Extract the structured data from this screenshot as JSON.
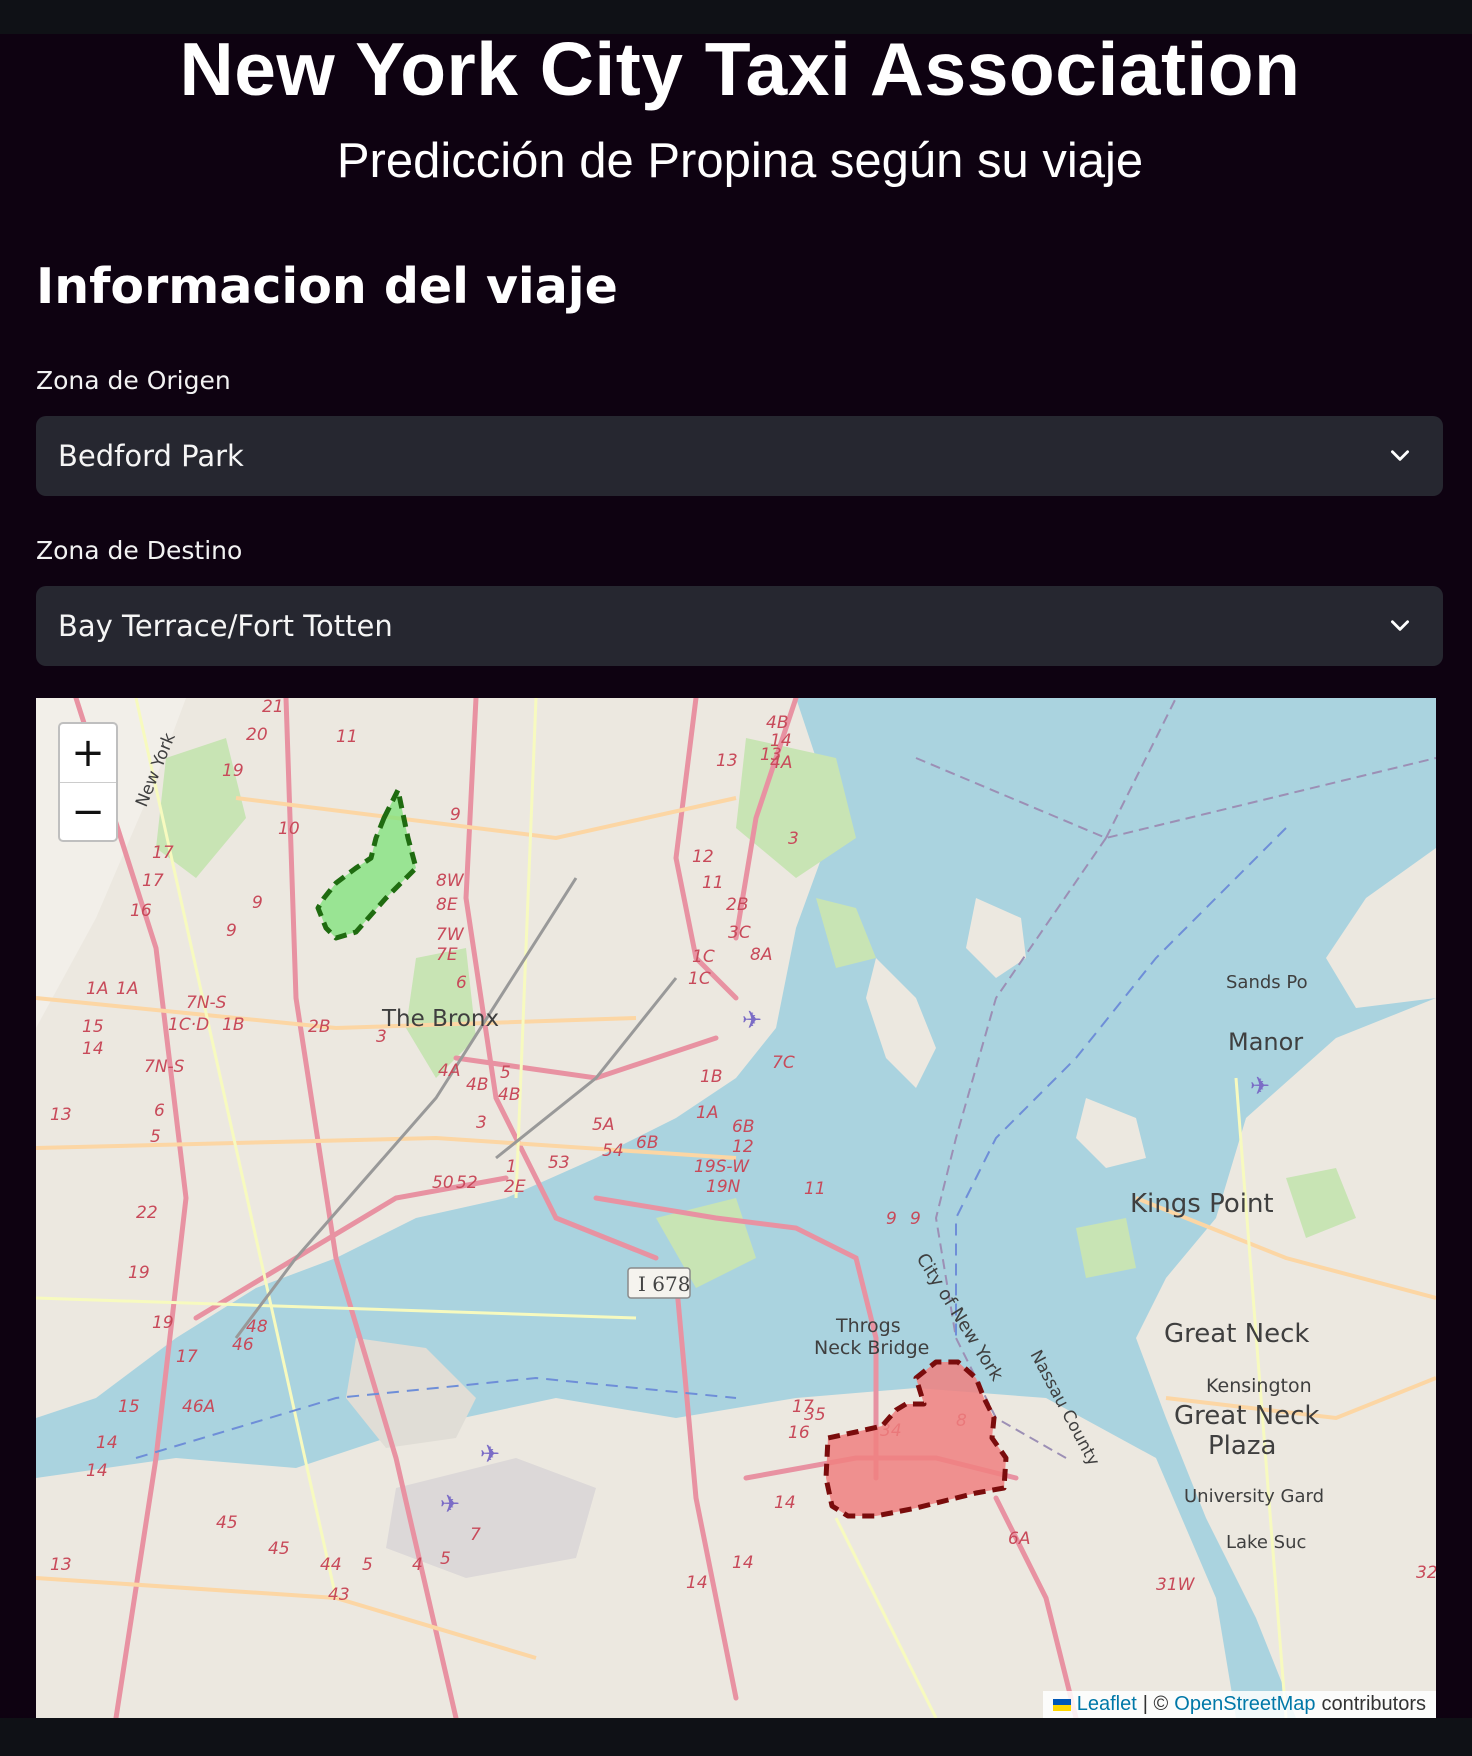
{
  "header": {
    "title": "New York City Taxi Association",
    "subtitle": "Predicción de Propina según su viaje"
  },
  "trip": {
    "heading": "Informacion del viaje",
    "origin": {
      "label": "Zona de Origen",
      "value": "Bedford Park"
    },
    "destination": {
      "label": "Zona de Destino",
      "value": "Bay Terrace/Fort Totten"
    }
  },
  "map": {
    "zoom_in": "+",
    "zoom_out": "−",
    "origin_color": "#00b000",
    "destination_color": "#e60000",
    "place_labels": {
      "bronx": "The Bronx",
      "kings_point": "Kings Point",
      "great_neck": "Great Neck",
      "great_neck_plaza_1": "Great Neck",
      "great_neck_plaza_2": "Plaza",
      "kensington": "Kensington",
      "manor": "Manor",
      "sands_point": "Sands Po",
      "throgs_1": "Throgs",
      "throgs_2": "Neck Bridge",
      "university": "University Gard",
      "lake": "Lake Suc",
      "i678": "I 678",
      "city_of_ny": "City of New York",
      "nassau": "Nassau County",
      "new_york": "New York"
    },
    "attribution": {
      "leaflet": "Leaflet",
      "separator": "| ©",
      "osm": "OpenStreetMap",
      "suffix": "contributors"
    }
  }
}
